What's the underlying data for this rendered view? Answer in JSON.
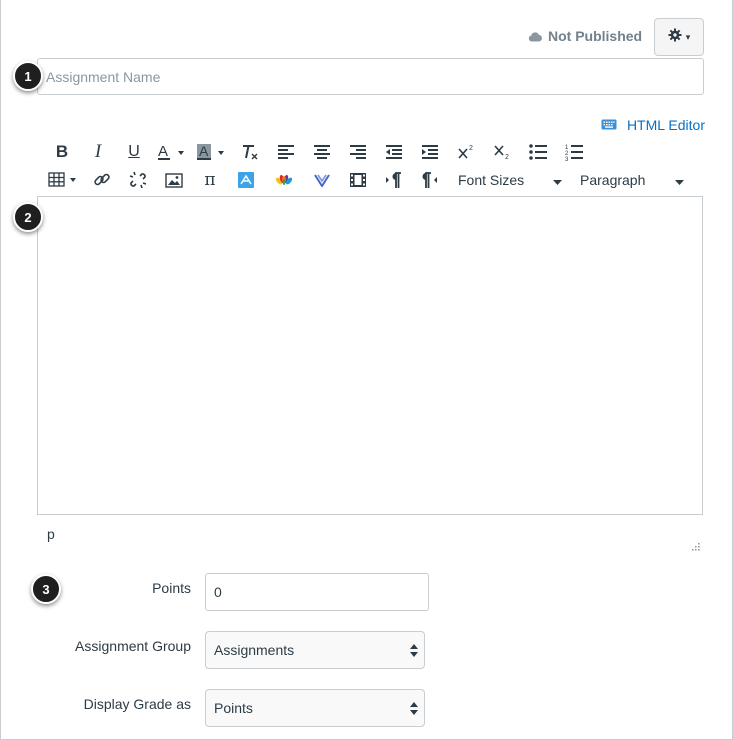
{
  "header": {
    "publish_status": "Not Published",
    "cloud_icon": "cloud-icon",
    "settings_icon": "gear-icon",
    "settings_caret": "▾"
  },
  "badges": [
    "1",
    "2",
    "3"
  ],
  "assignment_name": {
    "placeholder": "Assignment Name",
    "value": ""
  },
  "editor": {
    "html_editor_label": "HTML Editor",
    "html_editor_icon": "keyboard-icon",
    "toolbar_row1": [
      "bold",
      "italic",
      "underline",
      "text-color",
      "background-color",
      "clear-formatting",
      "align-left",
      "align-center",
      "align-right",
      "outdent",
      "indent",
      "superscript",
      "subscript",
      "bullet-list",
      "numbered-list"
    ],
    "toolbar_row2": [
      "table",
      "link",
      "unlink",
      "image",
      "math-equation",
      "embed",
      "media-apps",
      "vimeo",
      "media",
      "ltr",
      "rtl"
    ],
    "font_sizes_label": "Font Sizes",
    "paragraph_label": "Paragraph",
    "content": "",
    "path": "p"
  },
  "form": {
    "points": {
      "label": "Points",
      "value": "0"
    },
    "assignment_group": {
      "label": "Assignment Group",
      "selected": "Assignments"
    },
    "display_grade": {
      "label": "Display Grade as",
      "selected": "Points"
    }
  },
  "colors": {
    "link": "#0770c6",
    "text": "#2d3b45",
    "muted": "#73818c",
    "border": "#c7cdd1",
    "badge": "#1f1f1f"
  }
}
